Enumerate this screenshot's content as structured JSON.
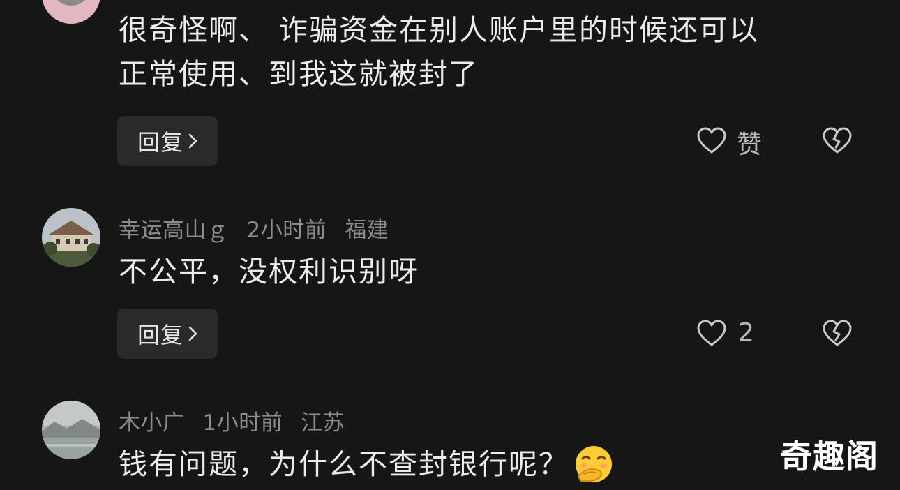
{
  "comments": [
    {
      "username": "",
      "time": "",
      "location": "",
      "lines": [
        "很奇怪啊、 诈骗资金在别人账户里的时候还可以",
        "正常使用、到我这就被封了"
      ],
      "reply_label": "回复",
      "like_label": "赞",
      "avatar": "pink-avatar"
    },
    {
      "username": "幸运高山ｇ",
      "time": "2小时前",
      "location": "福建",
      "lines": [
        "不公平，没权利识别呀"
      ],
      "reply_label": "回复",
      "like_label": "2",
      "avatar": "villa-avatar"
    },
    {
      "username": "木小广",
      "time": "1小时前",
      "location": "江苏",
      "lines": [
        "钱有问题，为什么不查封银行呢？"
      ],
      "emoji": "smiling-face-with-hand-over-mouth-emoji",
      "avatar": "misty-landscape-avatar"
    }
  ],
  "icons": {
    "reply_chevron": "chevron-right-icon",
    "like": "heart-outline-icon",
    "dislike": "broken-heart-icon"
  },
  "watermark": "奇趣阁",
  "colors": {
    "background": "#161616",
    "reply_button": "#2a2a2a",
    "meta_text": "#8c8c8c"
  }
}
